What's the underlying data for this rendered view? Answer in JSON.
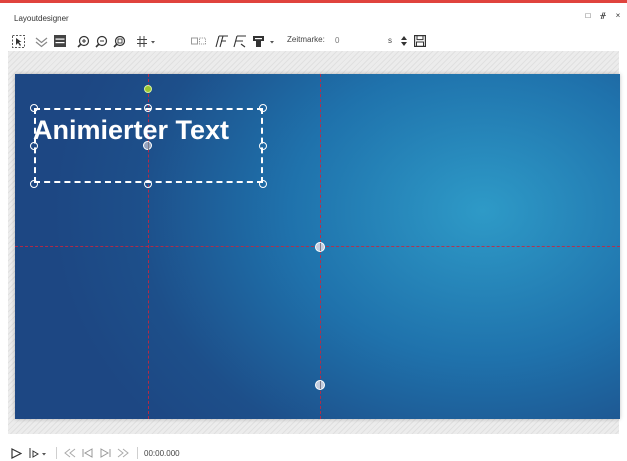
{
  "window": {
    "title": "Layoutdesigner",
    "accent_color": "#e0433d",
    "controls": {
      "restore_glyph": "□",
      "pin_glyph": "ᚌ",
      "close_glyph": "×"
    }
  },
  "toolbar": {
    "icons": [
      "select-icon",
      "snap-icon",
      "align-icon",
      "zoom-in-icon",
      "zoom-out-icon",
      "zoom-fit-icon",
      "grid-icon",
      "curve-path-icon",
      "motion-icon",
      "text-path-a-icon",
      "text-path-b-icon",
      "placeholder-icon"
    ],
    "zeitmarke_label": "Zeitmarke:",
    "zeitmarke_value": "0",
    "zeitmarke_unit": "s"
  },
  "canvas": {
    "text_object": "Animierter Text",
    "background_colors": [
      "#2e9ac7",
      "#1d4783"
    ],
    "guide_color": "#cd233c"
  },
  "playback": {
    "icons": [
      "play-icon",
      "play-options-icon",
      "prev-keyframe-icon",
      "to-start-icon",
      "to-end-icon",
      "next-keyframe-icon"
    ],
    "timecode": "00:00.000"
  }
}
